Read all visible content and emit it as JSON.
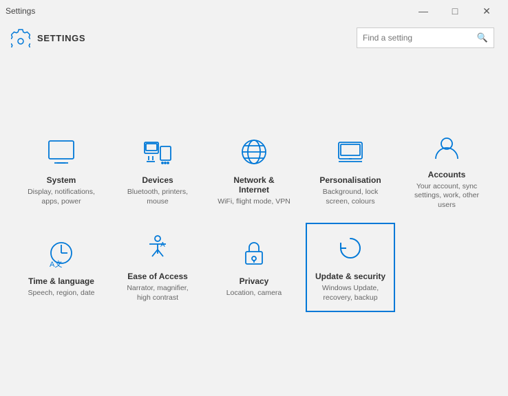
{
  "window": {
    "title": "Settings",
    "title_bar_title": "Settings",
    "controls": {
      "minimize": "—",
      "maximize": "□",
      "close": "✕"
    }
  },
  "header": {
    "logo_label": "Settings gear icon",
    "title": "SETTINGS",
    "search_placeholder": "Find a setting"
  },
  "tiles": [
    {
      "id": "system",
      "title": "System",
      "subtitle": "Display, notifications, apps, power",
      "icon": "system"
    },
    {
      "id": "devices",
      "title": "Devices",
      "subtitle": "Bluetooth, printers, mouse",
      "icon": "devices"
    },
    {
      "id": "network",
      "title": "Network & Internet",
      "subtitle": "WiFi, flight mode, VPN",
      "icon": "network"
    },
    {
      "id": "personalisation",
      "title": "Personalisation",
      "subtitle": "Background, lock screen, colours",
      "icon": "personalisation"
    },
    {
      "id": "accounts",
      "title": "Accounts",
      "subtitle": "Your account, sync settings, work, other users",
      "icon": "accounts"
    },
    {
      "id": "time-language",
      "title": "Time & language",
      "subtitle": "Speech, region, date",
      "icon": "time-language"
    },
    {
      "id": "ease-of-access",
      "title": "Ease of Access",
      "subtitle": "Narrator, magnifier, high contrast",
      "icon": "ease-of-access"
    },
    {
      "id": "privacy",
      "title": "Privacy",
      "subtitle": "Location, camera",
      "icon": "privacy"
    },
    {
      "id": "update-security",
      "title": "Update & security",
      "subtitle": "Windows Update, recovery, backup",
      "icon": "update-security",
      "active": true
    }
  ],
  "colors": {
    "accent": "#0078d7",
    "background": "#f2f2f2"
  }
}
